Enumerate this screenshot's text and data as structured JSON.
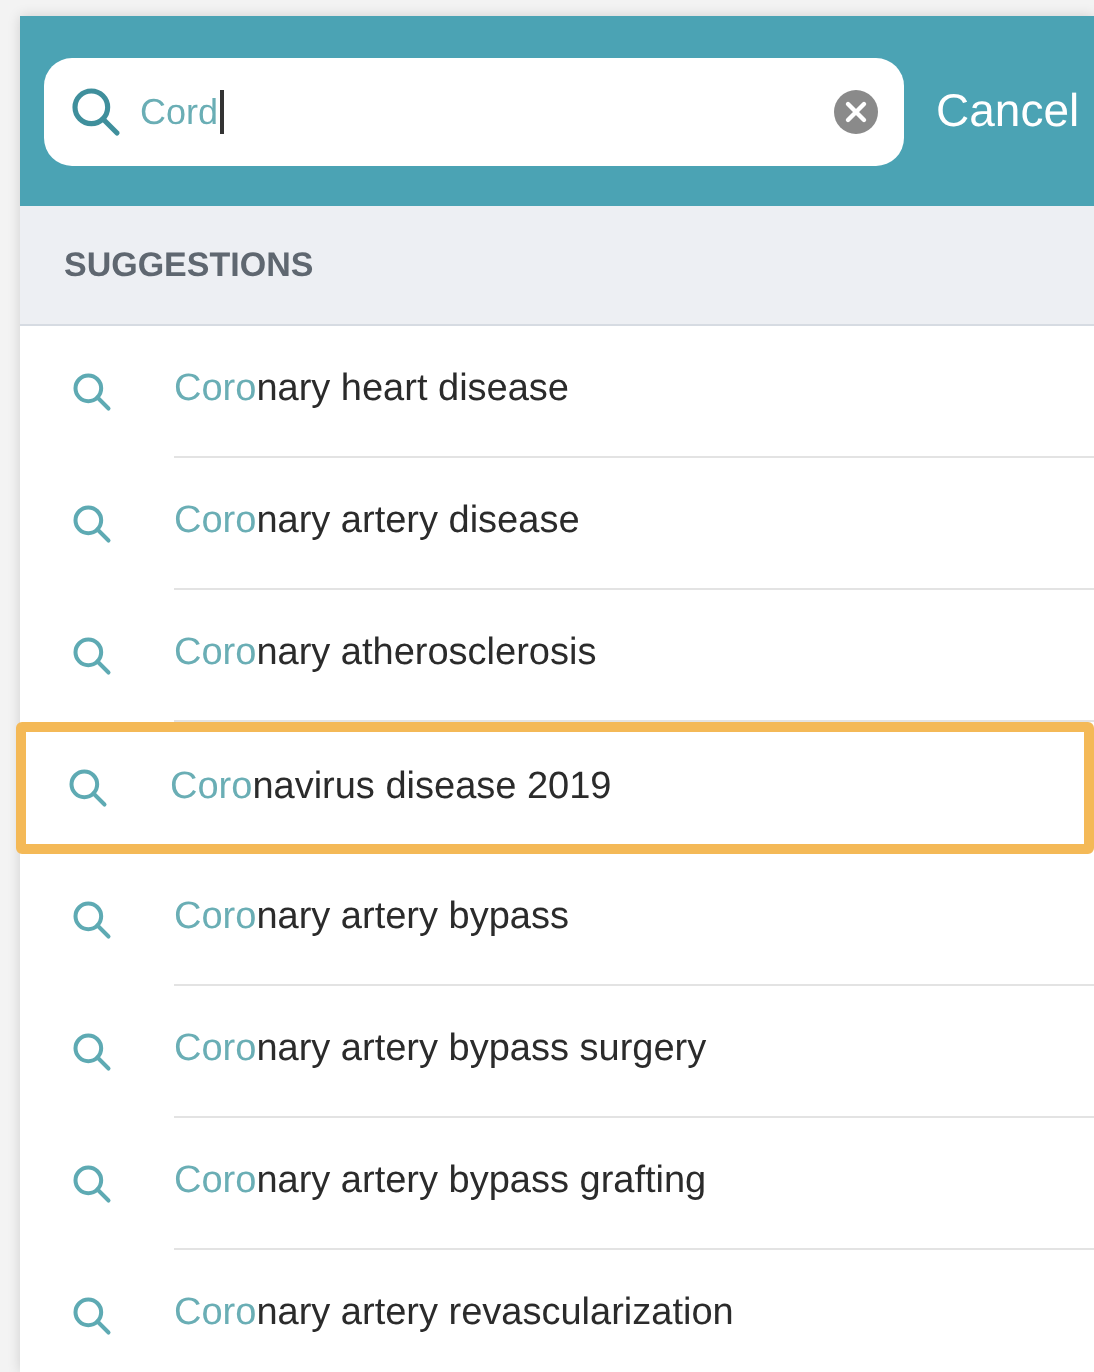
{
  "search": {
    "value": "Cord",
    "action": "Cancel"
  },
  "section_title": "SUGGESTIONS",
  "suggestions": [
    {
      "match": "Coro",
      "rest": "nary heart disease",
      "selected": false
    },
    {
      "match": "Coro",
      "rest": "nary artery disease",
      "selected": false
    },
    {
      "match": "Coro",
      "rest": "nary atherosclerosis",
      "selected": false
    },
    {
      "match": "Coro",
      "rest": "navirus disease 2019",
      "selected": true
    },
    {
      "match": "Coro",
      "rest": "nary artery bypass",
      "selected": false
    },
    {
      "match": "Coro",
      "rest": "nary artery bypass surgery",
      "selected": false
    },
    {
      "match": "Coro",
      "rest": "nary artery bypass grafting",
      "selected": false
    },
    {
      "match": "Coro",
      "rest": "nary artery revascularization",
      "selected": false
    }
  ]
}
